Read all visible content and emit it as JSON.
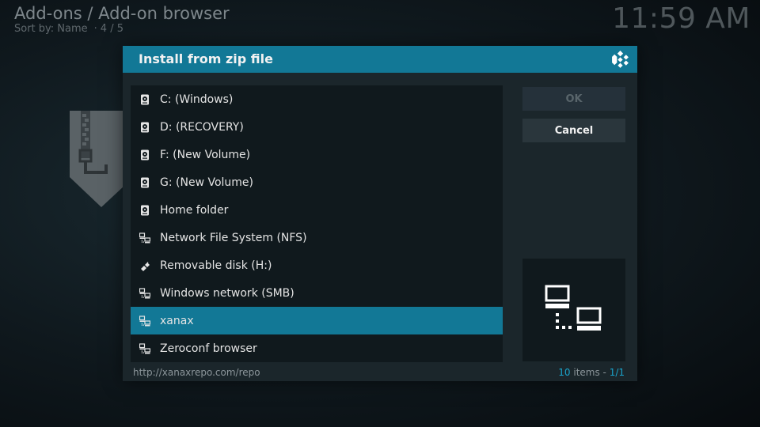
{
  "header": {
    "title": "Add-ons / Add-on browser",
    "sort_label": "Sort by: Name",
    "separator": "·",
    "position": "4 / 5"
  },
  "clock": "11:59 AM",
  "dialog": {
    "title": "Install from zip file",
    "ok_label": "OK",
    "cancel_label": "Cancel",
    "footer_path": "http://xanaxrepo.com/repo",
    "footer_count": "10",
    "footer_items_word": " items - ",
    "footer_page": "1/1"
  },
  "items": [
    {
      "label": "C: (Windows)",
      "icon": "harddisk-icon"
    },
    {
      "label": "D: (RECOVERY)",
      "icon": "harddisk-icon"
    },
    {
      "label": "F: (New Volume)",
      "icon": "harddisk-icon"
    },
    {
      "label": "G: (New Volume)",
      "icon": "harddisk-icon"
    },
    {
      "label": "Home folder",
      "icon": "harddisk-icon"
    },
    {
      "label": "Network File System (NFS)",
      "icon": "network-icon"
    },
    {
      "label": "Removable disk (H:)",
      "icon": "usb-icon"
    },
    {
      "label": "Windows network (SMB)",
      "icon": "network-icon"
    },
    {
      "label": "xanax",
      "icon": "network-icon",
      "selected": true
    },
    {
      "label": "Zeroconf browser",
      "icon": "network-icon"
    }
  ],
  "colors": {
    "accent": "#127896",
    "dialog_bg": "#1b262b",
    "list_bg": "#10191d",
    "highlight_text": "#1aa4cc"
  }
}
